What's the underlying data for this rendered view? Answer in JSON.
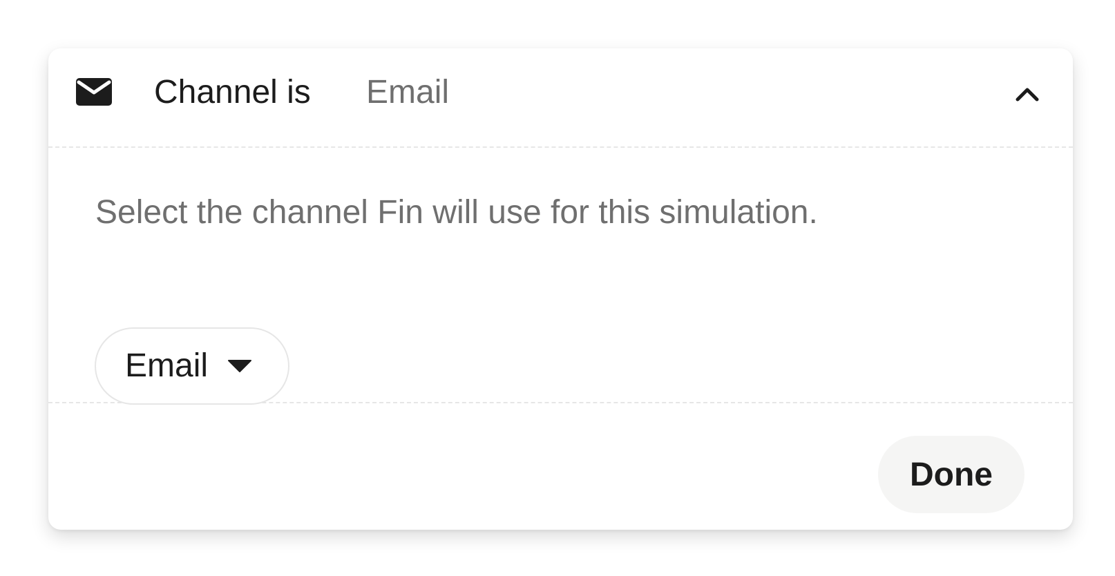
{
  "panel": {
    "header": {
      "icon": "mail-icon",
      "label": "Channel is",
      "value": "Email",
      "collapse_icon": "chevron-up-icon"
    },
    "description": "Select the channel Fin will use for this simulation.",
    "channel_select": {
      "selected": "Email",
      "icon": "caret-down-icon"
    },
    "done_label": "Done"
  },
  "colors": {
    "text_primary": "#1c1c1c",
    "text_secondary": "#6f6f6f",
    "divider": "#e6e6e6",
    "button_bg": "#f5f5f4"
  }
}
